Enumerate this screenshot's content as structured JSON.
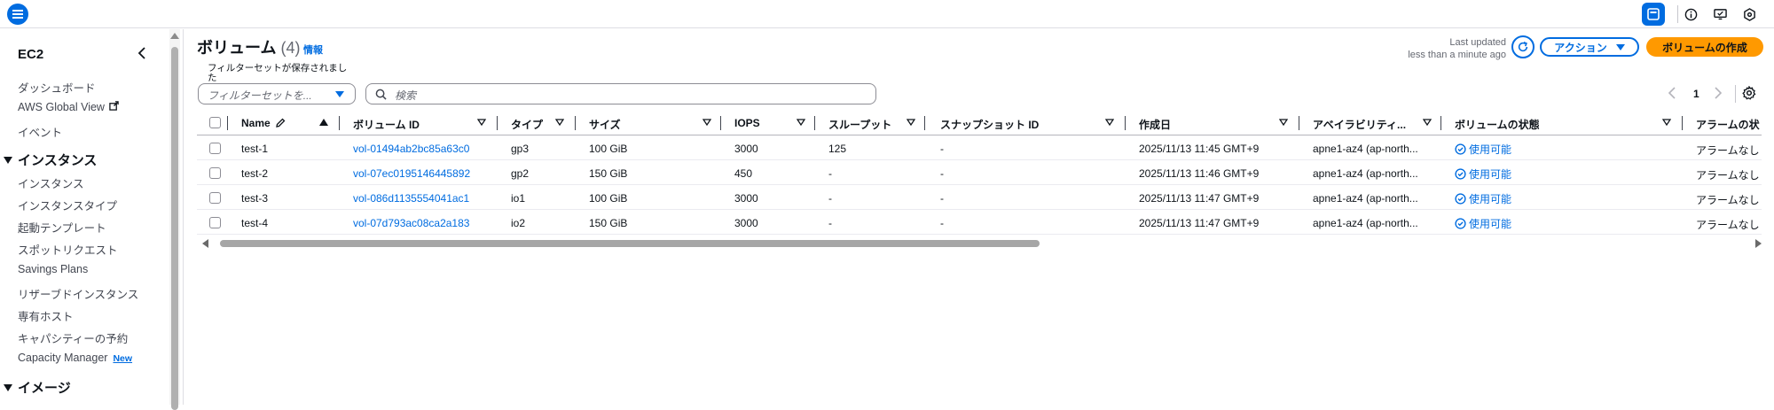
{
  "colors": {
    "accent": "#006ce0",
    "primary_button": "#ff9900",
    "status_ok": "#006ce0"
  },
  "sidebar": {
    "title": "EC2",
    "top_items": [
      {
        "label": "ダッシュボード"
      },
      {
        "label": "AWS Global View",
        "icon": "external-link-icon"
      },
      {
        "label": "イベント"
      }
    ],
    "instances_section": {
      "label": "インスタンス",
      "items": [
        {
          "label": "インスタンス"
        },
        {
          "label": "インスタンスタイプ"
        },
        {
          "label": "起動テンプレート"
        },
        {
          "label": "スポットリクエスト"
        },
        {
          "label": "Savings Plans"
        },
        {
          "label": "リザーブドインスタンス"
        },
        {
          "label": "専有ホスト"
        },
        {
          "label": "キャパシティーの予約"
        },
        {
          "label": "Capacity Manager",
          "badge": "New"
        }
      ]
    },
    "images_section": {
      "label": "イメージ"
    }
  },
  "header": {
    "title": "ボリューム",
    "count": "(4)",
    "info": "情報",
    "last_updated_line1": "Last updated",
    "last_updated_line2": "less than a minute ago",
    "action_button": "アクション",
    "create_button": "ボリュームの作成"
  },
  "filter": {
    "caption": "フィルターセットが保存されました",
    "placeholder": "フィルターセットを...",
    "search_placeholder": "検索"
  },
  "pagination": {
    "current_page": "1"
  },
  "table": {
    "columns": [
      "Name",
      "ボリューム ID",
      "タイプ",
      "サイズ",
      "IOPS",
      "スループット",
      "スナップショット ID",
      "作成日",
      "アベイラビリティ...",
      "ボリュームの状態",
      "アラームの状"
    ],
    "rows": [
      {
        "name": "test-1",
        "volume_id": "vol-01494ab2bc85a63c0",
        "type": "gp3",
        "size": "100 GiB",
        "iops": "3000",
        "throughput": "125",
        "snapshot": "-",
        "created": "2025/11/13 11:45 GMT+9",
        "az": "apne1-az4 (ap-north...",
        "state": "使用可能",
        "alarm": "アラームなし"
      },
      {
        "name": "test-2",
        "volume_id": "vol-07ec0195146445892",
        "type": "gp2",
        "size": "150 GiB",
        "iops": "450",
        "throughput": "-",
        "snapshot": "-",
        "created": "2025/11/13 11:46 GMT+9",
        "az": "apne1-az4 (ap-north...",
        "state": "使用可能",
        "alarm": "アラームなし"
      },
      {
        "name": "test-3",
        "volume_id": "vol-086d1135554041ac1",
        "type": "io1",
        "size": "100 GiB",
        "iops": "3000",
        "throughput": "-",
        "snapshot": "-",
        "created": "2025/11/13 11:47 GMT+9",
        "az": "apne1-az4 (ap-north...",
        "state": "使用可能",
        "alarm": "アラームなし"
      },
      {
        "name": "test-4",
        "volume_id": "vol-07d793ac08ca2a183",
        "type": "io2",
        "size": "150 GiB",
        "iops": "3000",
        "throughput": "-",
        "snapshot": "-",
        "created": "2025/11/13 11:47 GMT+9",
        "az": "apne1-az4 (ap-north...",
        "state": "使用可能",
        "alarm": "アラームなし"
      }
    ]
  }
}
